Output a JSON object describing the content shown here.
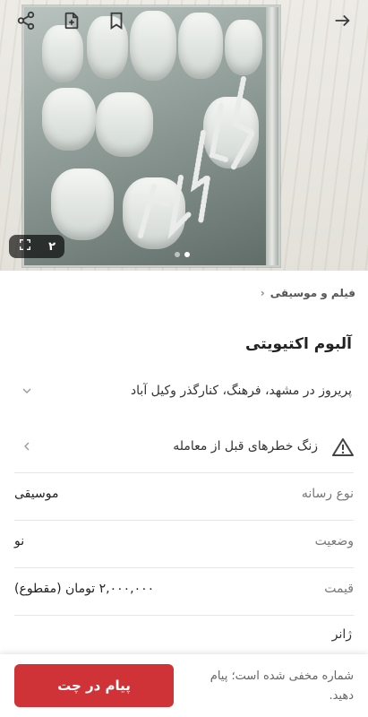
{
  "gallery": {
    "image_count": "۲",
    "total_images": 2,
    "active_index": 0,
    "icons": [
      "share-icon",
      "add-note-icon",
      "bookmark-icon",
      "back-arrow-icon",
      "fullscreen-icon"
    ]
  },
  "breadcrumb": {
    "category": "فیلم و موسیقی"
  },
  "listing": {
    "title": "آلبوم اکتیویتی",
    "location": "پریروز در مشهد، فرهنگ، کنارگذر وکیل آباد",
    "warning": "زنگ خطرهای قبل از معامله"
  },
  "details": [
    {
      "label": "نوع رسانه",
      "value": "موسیقی"
    },
    {
      "label": "وضعیت",
      "value": "نو"
    },
    {
      "label": "قیمت",
      "value": "۲,۰۰۰,۰۰۰ تومان (مقطوع)"
    }
  ],
  "genre_label": "ژانر",
  "bottom_bar": {
    "chat_label": "پیام در چت",
    "hidden_note": "شماره مخفی شده است؛ پیام دهید."
  },
  "colors": {
    "accent": "#d03337",
    "warning_icon": "#444444"
  }
}
